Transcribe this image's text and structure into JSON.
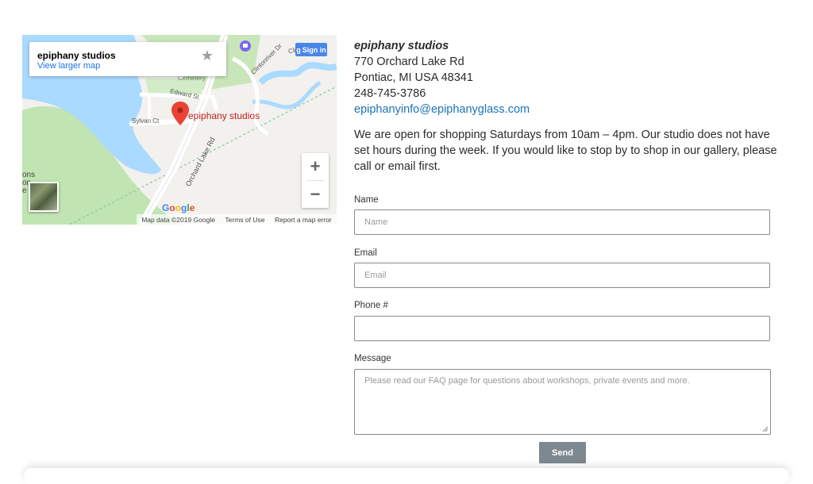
{
  "map": {
    "place_name": "epiphany studios",
    "view_larger": "View larger map",
    "signin_label": "Sign in",
    "marker_label": "epiphany studios",
    "roads": {
      "orchard": "Orchard Lake Rd",
      "sylvan": "Sylvan Ct",
      "edward": "Edward St",
      "clintonriver": "Clintonriver Dr",
      "clinton": "Clinton",
      "cemetery": "Cemetery"
    },
    "edge_text": "ons\non\ne",
    "zoom_in": "+",
    "zoom_out": "−",
    "google_logo": "Google",
    "footer": {
      "map_data": "Map data ©2019 Google",
      "terms": "Terms of Use",
      "report": "Report a map error"
    }
  },
  "contact": {
    "name": "epiphany studios",
    "address1": "770 Orchard Lake Rd",
    "address2": "Pontiac, MI USA 48341",
    "phone": "248-745-3786",
    "email": "epiphanyinfo@epiphanyglass.com",
    "hours": "We are open for shopping Saturdays from 10am – 4pm. Our studio does not have set hours during the week. If you would like to stop by to shop in our gallery, please call or email first."
  },
  "form": {
    "name_label": "Name",
    "name_placeholder": "Name",
    "email_label": "Email",
    "email_placeholder": "Email",
    "phone_label": "Phone #",
    "phone_placeholder": "",
    "message_label": "Message",
    "message_placeholder": "Please read our FAQ page for questions about workshops, private events and more.",
    "send_label": "Send"
  },
  "colors": {
    "link": "#1a73b7",
    "send_button": "#7d8890",
    "water": "#aadaff",
    "park": "#c0e4b2",
    "marker": "#ea4335"
  }
}
